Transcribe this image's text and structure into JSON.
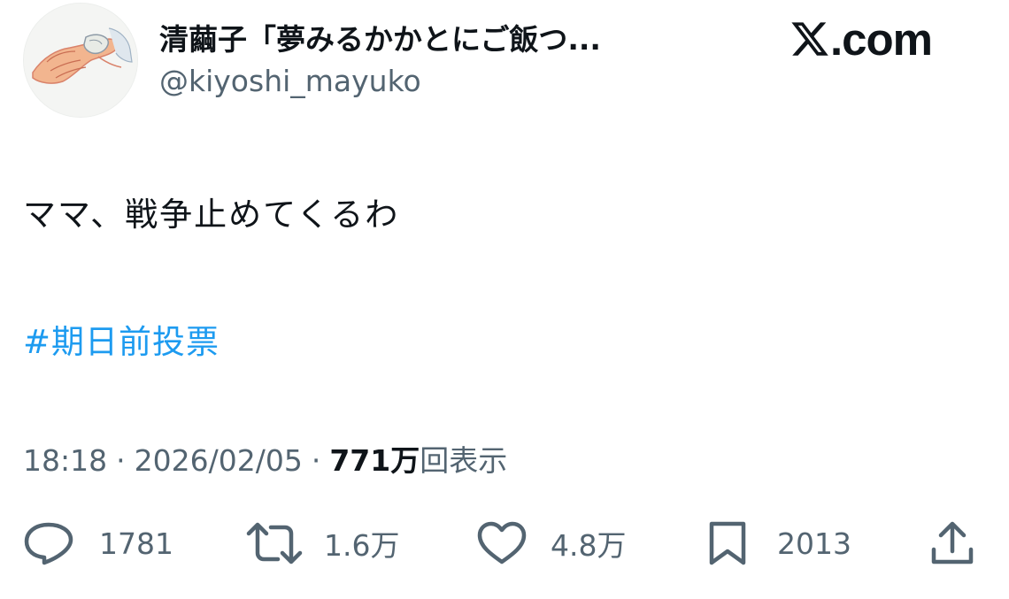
{
  "author": {
    "display_name": "清繭子「夢みるかかとにご飯つ...",
    "handle": "@kiyoshi_mayuko",
    "avatar_icon": "avatar-illustration-icon"
  },
  "brand": {
    "logo_icon": "x-logo-icon",
    "text": ".com"
  },
  "tweet": {
    "text": "ママ、戦争止めてくるわ",
    "hashtag": "#期日前投票"
  },
  "meta": {
    "time": "18:18",
    "separator": "·",
    "date": "2026/02/05",
    "views_count": "771万",
    "views_label": "回表示"
  },
  "actions": {
    "reply": {
      "icon": "reply-icon",
      "count": "1781"
    },
    "repost": {
      "icon": "repost-icon",
      "count": "1.6万"
    },
    "like": {
      "icon": "heart-icon",
      "count": "4.8万"
    },
    "bookmark": {
      "icon": "bookmark-icon",
      "count": "2013"
    },
    "share": {
      "icon": "share-icon"
    }
  },
  "colors": {
    "text_primary": "#0f1419",
    "text_secondary": "#536471",
    "link": "#1d9bf0",
    "background": "#ffffff"
  }
}
